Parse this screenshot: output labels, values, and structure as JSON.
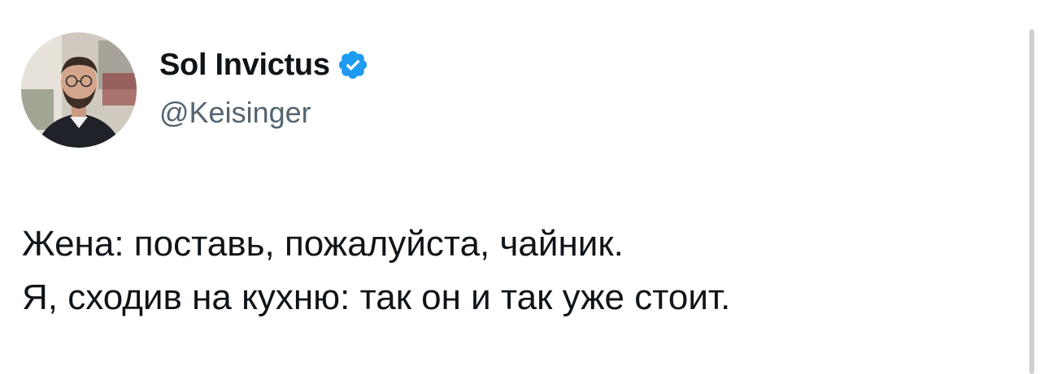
{
  "author": {
    "display_name": "Sol Invictus",
    "handle": "@Keisinger",
    "verified": true,
    "verified_icon": "verified-badge-icon",
    "badge_color": "#1d9bf0"
  },
  "tweet": {
    "lines": [
      "Жена: поставь, пожалуйста, чайник.",
      "Я, сходив на кухню: так он и так уже стоит."
    ]
  },
  "colors": {
    "text_primary": "#0f1419",
    "text_secondary": "#536471",
    "background": "#ffffff"
  }
}
